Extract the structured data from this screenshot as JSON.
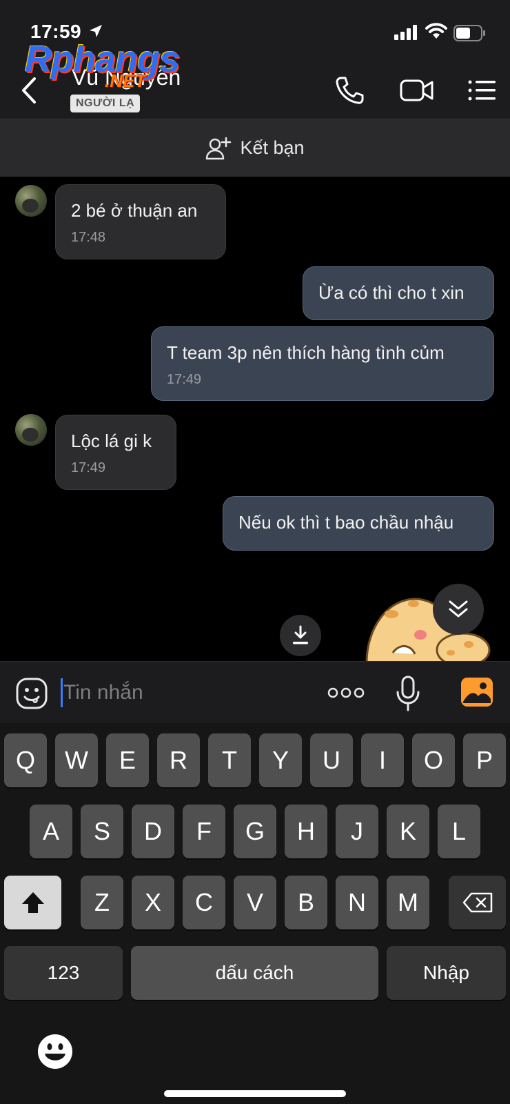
{
  "status_bar": {
    "time": "17:59"
  },
  "watermark": {
    "brand": "Rphangs",
    "suffix": ".NET"
  },
  "header": {
    "contact_name": "Vũ Nguyễn",
    "badge": "NGƯỜI LẠ"
  },
  "add_friend": {
    "label": "Kết bạn"
  },
  "messages": [
    {
      "direction": "in",
      "text": "2 bé ở thuận an",
      "time": "17:48"
    },
    {
      "direction": "out",
      "text": "Ừa có thì cho t xin",
      "time": ""
    },
    {
      "direction": "out",
      "text": "T team 3p nên thích hàng tình củm",
      "time": "17:49"
    },
    {
      "direction": "in",
      "text": "Lộc lá gi k",
      "time": "17:49"
    },
    {
      "direction": "out",
      "text": "Nếu ok thì t bao chầu nhậu",
      "time": ""
    }
  ],
  "composer": {
    "placeholder": "Tin nhắn",
    "value": ""
  },
  "keyboard": {
    "row1": [
      "Q",
      "W",
      "E",
      "R",
      "T",
      "Y",
      "U",
      "I",
      "O",
      "P"
    ],
    "row2": [
      "A",
      "S",
      "D",
      "F",
      "G",
      "H",
      "J",
      "K",
      "L"
    ],
    "row3": [
      "Z",
      "X",
      "C",
      "V",
      "B",
      "N",
      "M"
    ],
    "numbers_key": "123",
    "space_key": "dấu cách",
    "return_key": "Nhập"
  },
  "colors": {
    "header_bg": "#1c1c1e",
    "incoming_bubble": "#2c2c2e",
    "outgoing_bubble": "#3b4452",
    "accent_photo": "#ff9a2e",
    "caret": "#3a7bff"
  },
  "icons": {
    "header": [
      "back-chevron-icon",
      "phone-icon",
      "video-camera-icon",
      "menu-list-icon"
    ],
    "add_friend": "add-user-icon",
    "composer": [
      "sticker-smile-icon",
      "more-dots-icon",
      "microphone-icon",
      "photo-gallery-icon"
    ]
  }
}
